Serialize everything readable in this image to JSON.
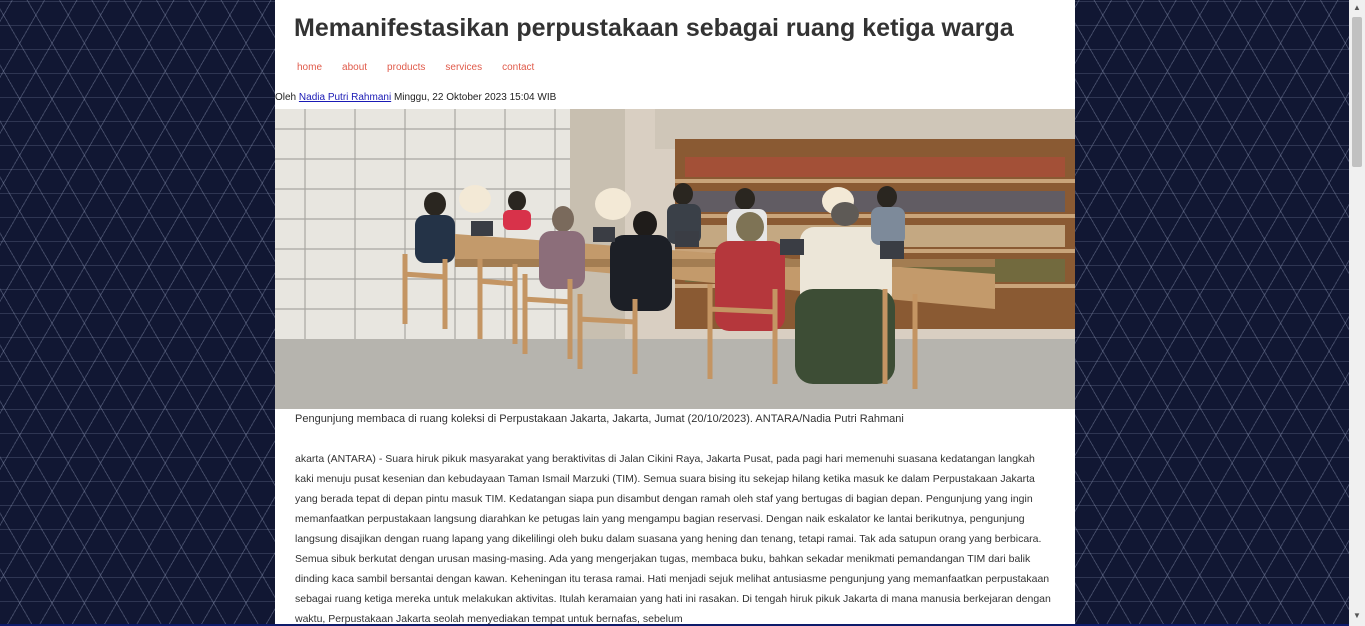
{
  "article": {
    "title": "Memanifestasikan perpustakaan sebagai ruang ketiga warga",
    "byline_prefix": "Oleh",
    "author": "Nadia Putri Rahmani",
    "date": "Minggu, 22 Oktober 2023 15:04 WIB",
    "caption": "Pengunjung membaca di ruang koleksi di Perpustakaan Jakarta, Jakarta, Jumat (20/10/2023). ANTARA/Nadia Putri Rahmani",
    "body": "akarta (ANTARA) - Suara hiruk pikuk masyarakat yang beraktivitas di Jalan Cikini Raya, Jakarta Pusat, pada pagi hari memenuhi suasana kedatangan langkah kaki menuju pusat kesenian dan kebudayaan Taman Ismail Marzuki (TIM). Semua suara bising itu sekejap hilang ketika masuk ke dalam Perpustakaan Jakarta yang berada tepat di depan pintu masuk TIM. Kedatangan siapa pun disambut dengan ramah oleh staf yang bertugas di bagian depan. Pengunjung yang ingin memanfaatkan perpustakaan langsung diarahkan ke petugas lain yang mengampu bagian reservasi. Dengan naik eskalator ke lantai berikutnya, pengunjung langsung disajikan dengan ruang lapang yang dikelilingi oleh buku dalam suasana yang hening dan tenang, tetapi ramai. Tak ada satupun orang yang berbicara. Semua sibuk berkutat dengan urusan masing-masing. Ada yang mengerjakan tugas, membaca buku, bahkan sekadar menikmati pemandangan TIM dari balik dinding kaca sambil bersantai dengan kawan. Keheningan itu terasa ramai. Hati menjadi sejuk melihat antusiasme pengunjung yang memanfaatkan perpustakaan sebagai ruang ketiga mereka untuk melakukan aktivitas. Itulah keramaian yang hati ini rasakan. Di tengah hiruk pikuk Jakarta di mana manusia berkejaran dengan waktu, Perpustakaan Jakarta seolah menyediakan tempat untuk bernafas, sebelum"
  },
  "nav": {
    "home": "home",
    "about": "about",
    "products": "products",
    "services": "services",
    "contact": "contact"
  },
  "colors": {
    "background": "#111733",
    "nav_link": "#e05a4a",
    "author_link": "#1a1ab5",
    "title": "#333333"
  }
}
